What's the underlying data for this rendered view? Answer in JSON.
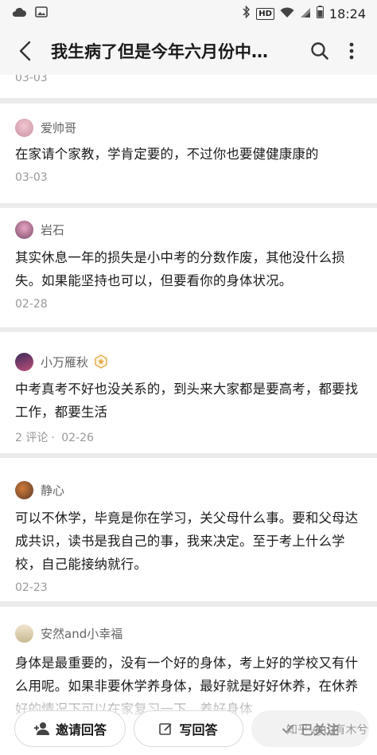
{
  "status_bar": {
    "time": "18:24",
    "hd": "HD"
  },
  "header": {
    "title": "我生病了但是今年六月份中…"
  },
  "first_card": {
    "date": "03-03"
  },
  "comments": [
    {
      "author": "爱帅哥",
      "text": "在家请个家教，学肯定要的，不过你也要健健康康的",
      "meta_count": "",
      "date": "03-03",
      "avatar_colors": [
        "#f3c7d2",
        "#c98fa0"
      ]
    },
    {
      "author": "岩石",
      "text": "其实休息一年的损失是小中考的分数作废，其他没什么损失。如果能坚持也可以，但要看你的身体状况。",
      "meta_count": "",
      "date": "02-28",
      "avatar_colors": [
        "#e9a6c3",
        "#7a4a6a"
      ]
    },
    {
      "author": "小万雁秋",
      "text": "中考真考不好也没关系的，到头来大家都是要高考，都要找工作，都要生活",
      "meta_count": "2 评论",
      "date": "02-26",
      "avatar_colors": [
        "#3a2a5a",
        "#c0507a"
      ]
    },
    {
      "author": "静心",
      "text": "可以不休学，毕竟是你在学习，关父母什么事。要和父母达成共识，读书是我自己的事，我来决定。至于考上什么学校，自己能接纳就行。",
      "meta_count": "",
      "date": "02-23",
      "avatar_colors": [
        "#5a3a2a",
        "#d07a3a"
      ]
    },
    {
      "author": "安然and小幸福",
      "text": "身体是最重要的，没有一个好的身体，考上好的学校又有什么用呢。如果非要休学养身体，最好就是好好休养，在休养好的情况下可以在家复习一下，养好身体",
      "meta_count": "",
      "date": "",
      "avatar_colors": [
        "#f0e6d0",
        "#c8b890"
      ]
    }
  ],
  "bottom_bar": {
    "invite_label": "邀请回答",
    "write_label": "写回答",
    "follow_label": "已关注"
  },
  "watermark": "知乎 @山有木兮"
}
